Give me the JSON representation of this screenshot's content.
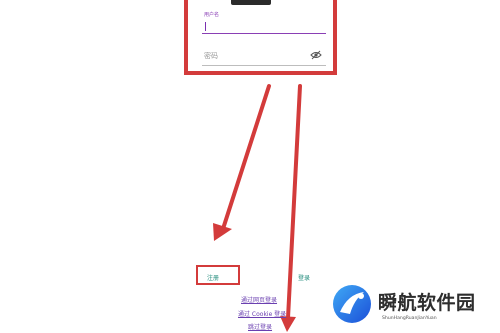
{
  "form": {
    "username_hint": "用户名",
    "password_placeholder": "密码",
    "password_visibility_icon": "eye-off-icon"
  },
  "actions": {
    "register_label": "注册",
    "login_label": "登录"
  },
  "links": {
    "web_login": "通过网页登录",
    "cookie_login": "通过 Cookie 登录",
    "skip_login": "跳过登录"
  },
  "watermark": {
    "title": "瞬航软件园",
    "subtitle": "ShunHangRuanJianYuan"
  },
  "colors": {
    "accent": "#8a3fb5",
    "annotation": "#d33b3b",
    "button_text": "#1f8a7a",
    "link_text": "#6a3fb0"
  }
}
